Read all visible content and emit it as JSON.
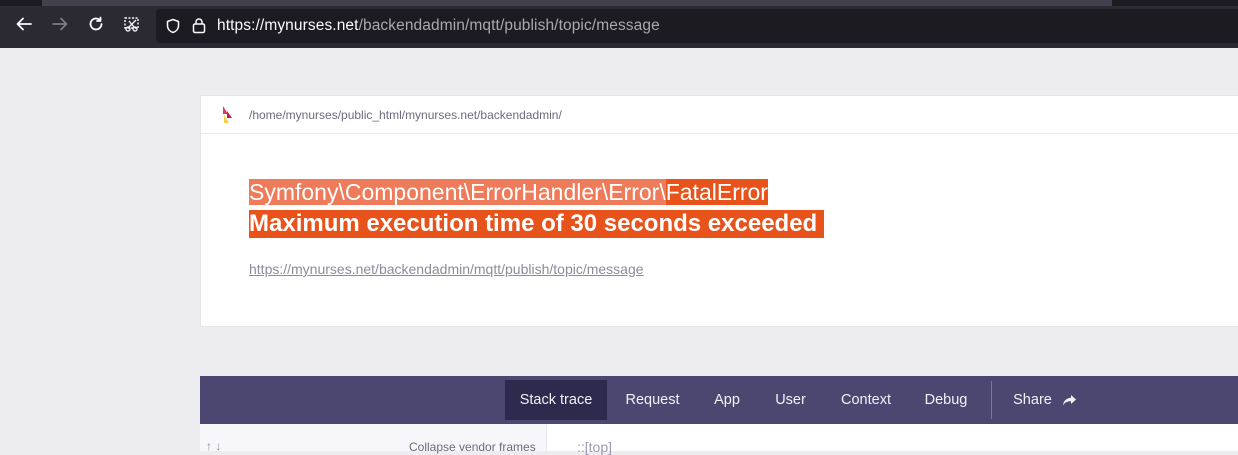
{
  "browser": {
    "url_host": "https://mynurses.net",
    "url_path": "/backendadmin/mqtt/publish/topic/message",
    "buttons": {
      "back": "back-arrow-icon",
      "forward": "forward-arrow-icon",
      "reload": "reload-icon",
      "extension": "screenshot-icon"
    }
  },
  "error_page": {
    "path": "/home/mynurses/public_html/mynurses.net/backendadmin/",
    "exception_class_prefix": "Symfony\\Component\\ErrorHandler\\Error\\",
    "exception_class_name": "FatalError",
    "message": "Maximum execution time of 30 seconds exceeded",
    "request_url": "https://mynurses.net/backendadmin/mqtt/publish/topic/message"
  },
  "tabs": [
    {
      "label": "Stack trace",
      "active": true
    },
    {
      "label": "Request"
    },
    {
      "label": "App"
    },
    {
      "label": "User"
    },
    {
      "label": "Context"
    },
    {
      "label": "Debug"
    }
  ],
  "share_label": "Share",
  "stack": {
    "sort_arrows": "↑ ↓",
    "collapse_label": "Collapse vendor frames",
    "top_label": "::[top]"
  },
  "colors": {
    "accent": "#e8531c",
    "selection": "#ee7b5a",
    "tabbar": "#4b4771",
    "tab_active": "#2d2a4d"
  }
}
